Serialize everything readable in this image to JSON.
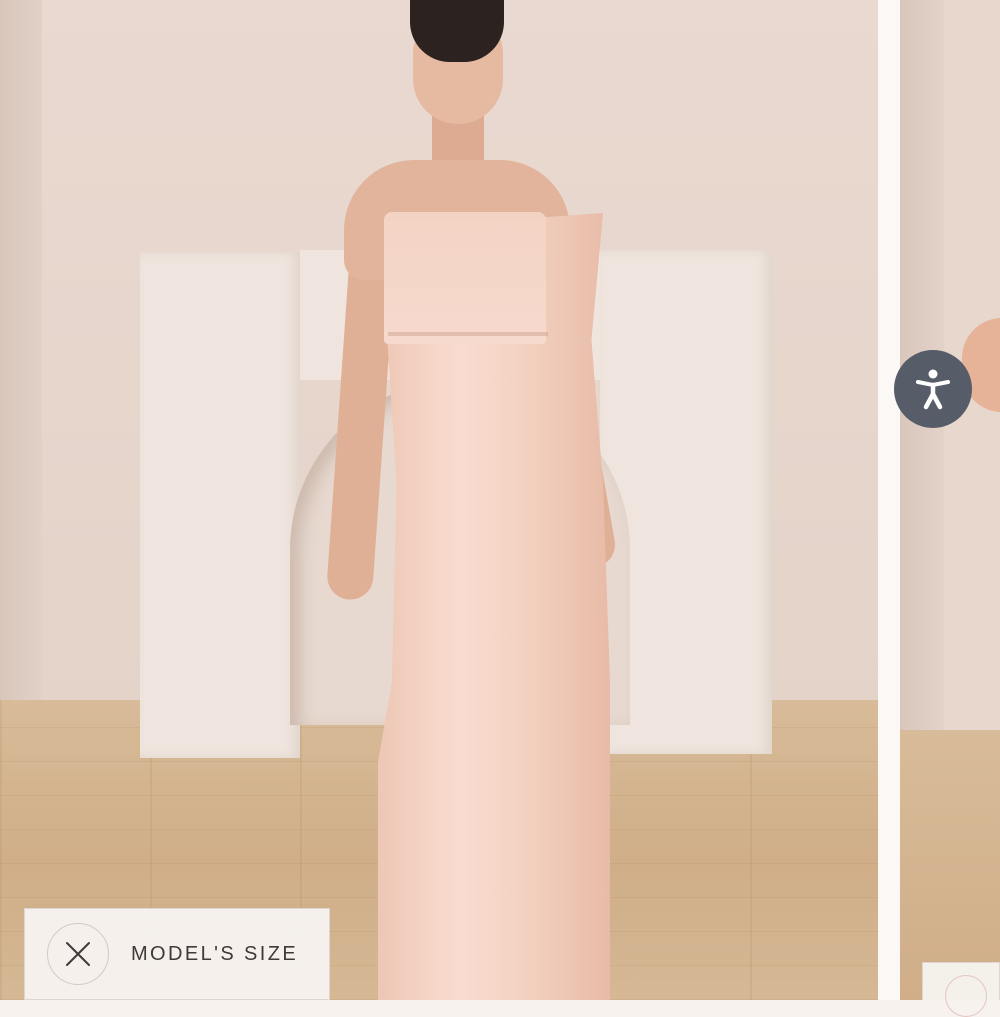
{
  "gallery": {
    "current_slide": {
      "image_alt": ""
    },
    "model_size": {
      "label": "MODEL'S SIZE",
      "close_icon": "close-icon"
    }
  },
  "accessibility": {
    "icon": "accessibility-person-icon",
    "color": "#565c68"
  },
  "colors": {
    "dress": "#f4d3c3",
    "wall": "#e6d5cb",
    "floor": "#d3b38e"
  }
}
